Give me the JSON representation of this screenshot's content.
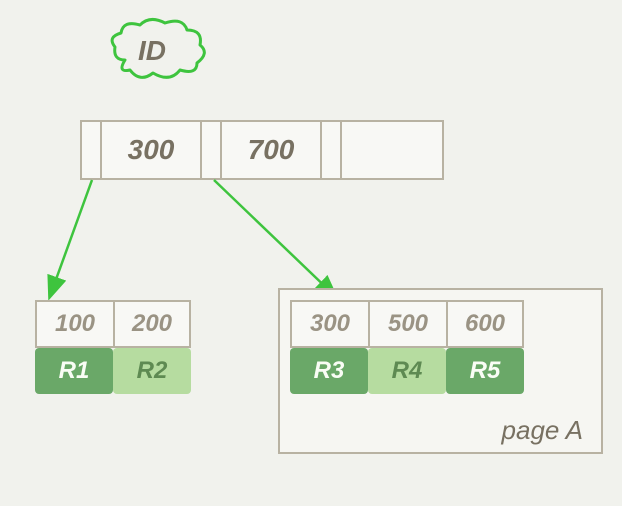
{
  "index_label": "ID",
  "root": {
    "keys": [
      "300",
      "700"
    ]
  },
  "leaf_left": {
    "keys": [
      "100",
      "200"
    ],
    "records": [
      "R1",
      "R2"
    ]
  },
  "leaf_right": {
    "keys": [
      "300",
      "500",
      "600"
    ],
    "records": [
      "R3",
      "R4",
      "R5"
    ],
    "page_label": "page A"
  }
}
